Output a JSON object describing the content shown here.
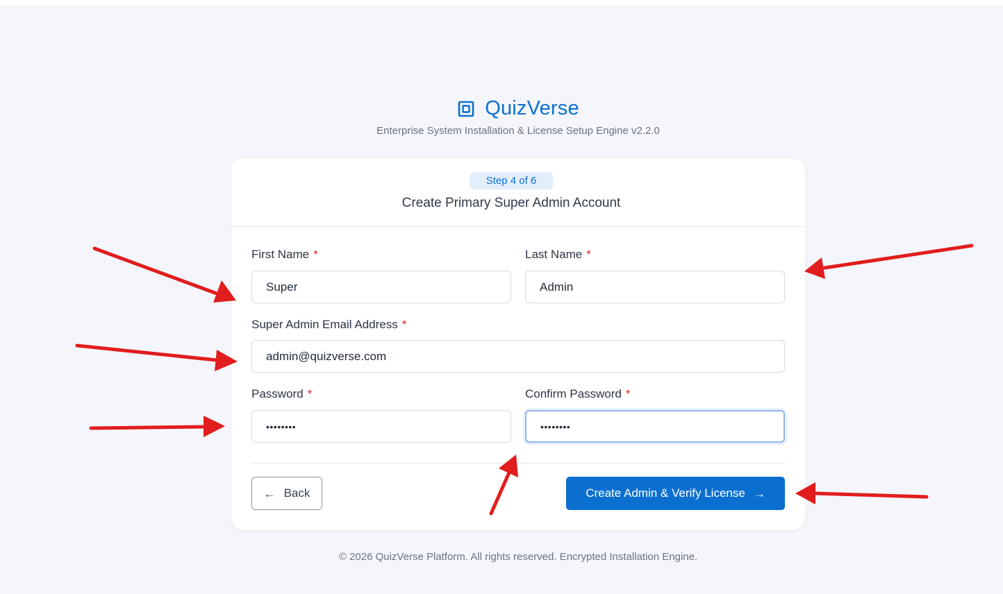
{
  "brand": {
    "name": "QuizVerse",
    "subtitle": "Enterprise System Installation & License Setup Engine v2.2.0",
    "accent_color": "#0b6fd0",
    "icon": "square-target-icon"
  },
  "card": {
    "step_badge": "Step 4 of 6",
    "title": "Create Primary Super Admin Account"
  },
  "form": {
    "first_name": {
      "label": "First Name",
      "value": "Super",
      "required_mark": "*"
    },
    "last_name": {
      "label": "Last Name",
      "value": "Admin",
      "required_mark": "*"
    },
    "email": {
      "label": "Super Admin Email Address",
      "value": "admin@quizverse.com",
      "required_mark": "*"
    },
    "password": {
      "label": "Password",
      "masked_value": "••••••••",
      "required_mark": "*"
    },
    "confirm_password": {
      "label": "Confirm Password",
      "masked_value": "••••••••",
      "required_mark": "*",
      "focused": true
    }
  },
  "actions": {
    "back_icon": "←",
    "back_label": "Back",
    "submit_label": "Create Admin & Verify License",
    "submit_icon": "→"
  },
  "footer": {
    "text": "© 2026 QuizVerse Platform. All rights reserved. Encrypted Installation Engine."
  },
  "annotations": {
    "arrow_color": "#e11d1d",
    "count": 6
  }
}
